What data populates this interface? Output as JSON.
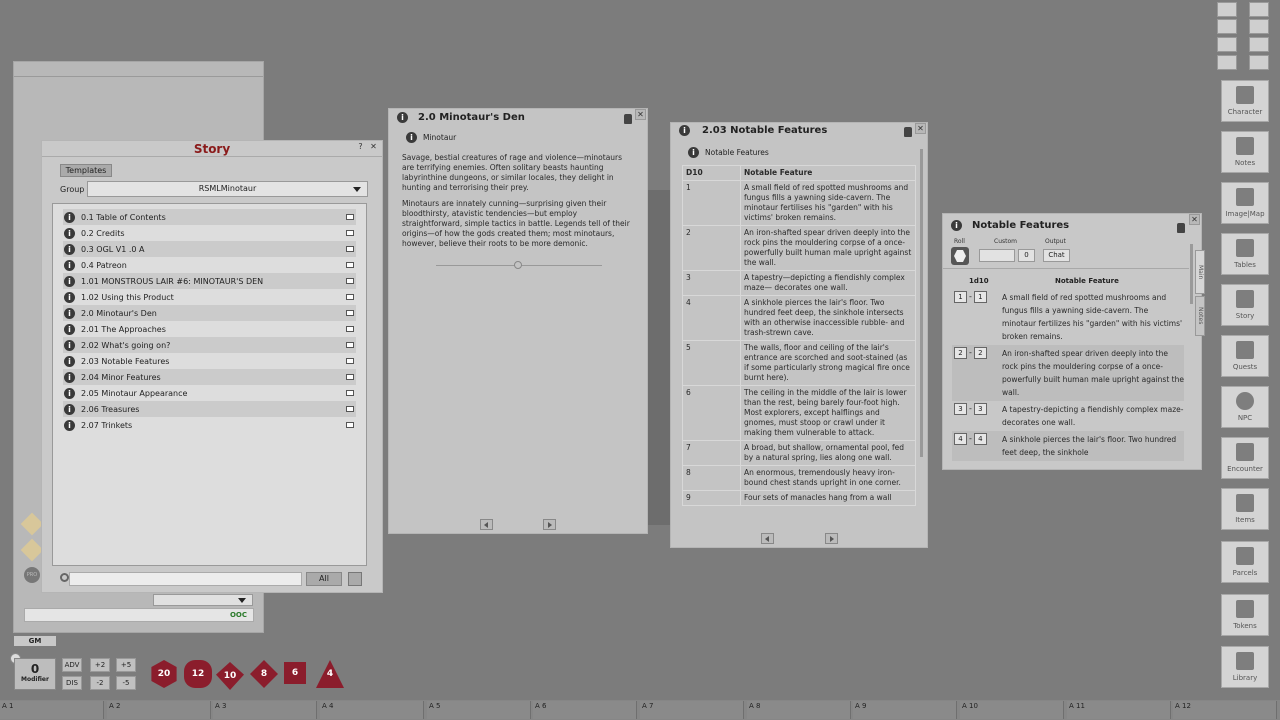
{
  "story": {
    "title": "Story",
    "tab_templates": "Templates",
    "group_label": "Group",
    "group_value": "RSMLMinotaur",
    "items": [
      "0.1 Table of Contents",
      "0.2 Credits",
      "0.3 OGL V1 .0 A",
      "0.4 Patreon",
      "1.01 MONSTROUS LAIR #6: MINOTAUR'S DEN",
      "1.02 Using this Product",
      "2.0 Minotaur's Den",
      "2.01 The Approaches",
      "2.02 What's going on?",
      "2.03 Notable Features",
      "2.04 Minor Features",
      "2.05 Minotaur Appearance",
      "2.06 Treasures",
      "2.07 Trinkets"
    ],
    "filter_all": "All"
  },
  "den": {
    "title": "2.0 Minotaur's Den",
    "subtitle": "Minotaur",
    "p1": "Savage, bestial creatures of rage and violence—minotaurs are terrifying enemies. Often solitary beasts haunting labyrinthine dungeons, or similar locales, they delight in hunting and terrorising their prey.",
    "p2": "Minotaurs are innately cunning—surprising given their bloodthirsty, atavistic tendencies—but employ straightforward, simple tactics in battle. Legends tell of their origins—of how the gods created them; most minotaurs, however, believe their roots to be more demonic."
  },
  "nf_table": {
    "title": "2.03 Notable Features",
    "subtitle": "Notable Features",
    "col_die": "D10",
    "col_feature": "Notable Feature",
    "rows": [
      {
        "n": "1",
        "t": "A small field of red spotted mushrooms and fungus fills a yawning side-cavern. The minotaur fertilises his \"garden\" with his victims' broken remains."
      },
      {
        "n": "2",
        "t": "An iron-shafted spear driven deeply into the rock pins the mouldering corpse of a once-powerfully built human male upright against the wall."
      },
      {
        "n": "3",
        "t": "A tapestry—depicting a fiendishly complex maze— decorates one wall."
      },
      {
        "n": "4",
        "t": "A sinkhole pierces the lair's floor. Two hundred feet deep, the sinkhole intersects with an otherwise inaccessible rubble- and trash-strewn cave."
      },
      {
        "n": "5",
        "t": "The walls, floor and ceiling of the lair's entrance are scorched and soot-stained (as if some particularly strong magical fire once burnt here)."
      },
      {
        "n": "6",
        "t": "The ceiling in the middle of the lair is lower than the rest, being barely four-foot high. Most explorers, except halflings and gnomes, must stoop or crawl under it making them vulnerable to attack."
      },
      {
        "n": "7",
        "t": "A broad, but shallow, ornamental pool, fed by a natural spring, lies along one wall."
      },
      {
        "n": "8",
        "t": "An enormous, tremendously heavy iron-bound chest stands upright in one corner."
      },
      {
        "n": "9",
        "t": "Four sets of manacles hang from a wall"
      }
    ]
  },
  "nf_roll": {
    "title": "Notable Features",
    "roll_label": "Roll",
    "custom_label": "Custom",
    "custom_value": "0",
    "output_label": "Output",
    "output_value": "Chat",
    "die_label": "1d10",
    "col_feature": "Notable Feature",
    "side_tab_main": "Main",
    "side_tab_notes": "Notes",
    "rows": [
      {
        "a": "1",
        "b": "1",
        "t": "A small field of red spotted mushrooms and fungus fills a yawning side-cavern. The minotaur fertilizes his \"garden\" with his victims' broken remains."
      },
      {
        "a": "2",
        "b": "2",
        "t": "An iron-shafted spear driven deeply into the rock pins the mouldering corpse of a once-powerfully built human male upright against the wall."
      },
      {
        "a": "3",
        "b": "3",
        "t": "A tapestry-depicting a fiendishly complex maze- decorates one wall."
      },
      {
        "a": "4",
        "b": "4",
        "t": "A sinkhole pierces the lair's floor. Two hundred feet deep, the sinkhole"
      }
    ]
  },
  "sidebar": [
    {
      "label": "Character",
      "icon": "character-icon"
    },
    {
      "label": "Notes",
      "icon": "feather-icon"
    },
    {
      "label": "Image|Map",
      "icon": "image-icon"
    },
    {
      "label": "Tables",
      "icon": "table-icon"
    },
    {
      "label": "Story",
      "icon": "book-icon"
    },
    {
      "label": "Quests",
      "icon": "flag-icon"
    },
    {
      "label": "NPC",
      "icon": "person-icon"
    },
    {
      "label": "Encounter",
      "icon": "lightning-icon"
    },
    {
      "label": "Items",
      "icon": "sword-icon"
    },
    {
      "label": "Parcels",
      "icon": "box-icon"
    },
    {
      "label": "Tokens",
      "icon": "layers-icon"
    },
    {
      "label": "Library",
      "icon": "library-icon"
    }
  ],
  "chat": {
    "ooc": "OOC",
    "gm": "GM"
  },
  "modifier": {
    "value": "0",
    "label": "Modifier",
    "adv": "ADV",
    "dis": "DIS",
    "p2": "+2",
    "p5": "+5",
    "m2": "-2",
    "m5": "-5"
  },
  "dice": [
    "20",
    "12",
    "10",
    "8",
    "6",
    "4"
  ],
  "hotkeys": [
    "A 1",
    "A 2",
    "A 3",
    "A 4",
    "A 5",
    "A 6",
    "A 7",
    "A 8",
    "A 9",
    "A 10",
    "A 11",
    "A 12"
  ]
}
